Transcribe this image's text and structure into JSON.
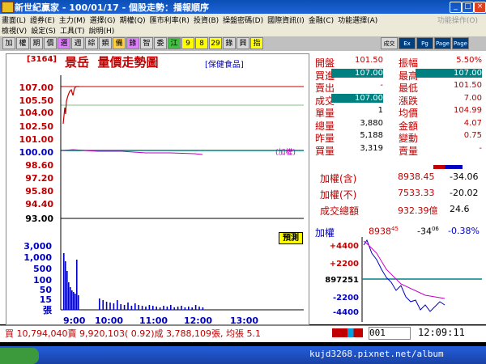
{
  "window": {
    "title": "新世紀贏家 - 100/01/17 - 個股走勢：播報順序"
  },
  "menu": {
    "row1": [
      "畫面(L)",
      "證券(E)",
      "主力(M)",
      "選擇(G)",
      "期權(Q)",
      "匯市利率(R)",
      "投資(B)",
      "操盤密碼(D)",
      "國際資訊(I)",
      "金融(C)",
      "功能選擇(A)"
    ],
    "row2": [
      "檢視(V)",
      "設定(S)",
      "工具(T)",
      "說明(H)"
    ],
    "right": "功能操作(O)"
  },
  "toolbar": {
    "buttons": [
      "加",
      "權",
      "期",
      "價",
      "選",
      "週",
      "綜",
      "類",
      "備",
      "錄",
      "智",
      "委",
      "江",
      "9",
      "8",
      "29",
      "錄",
      "興",
      "指"
    ],
    "right": [
      "成交",
      "Ex",
      "Pg",
      "Page",
      "Page"
    ]
  },
  "stock": {
    "code": "[3164]",
    "name": "景岳",
    "chart_title": "量價走勢圖",
    "category": "[保健食品]",
    "weight_tag": "(加權)"
  },
  "quote": {
    "rows": [
      {
        "l": "開盤",
        "v": "101.50",
        "l2": "振幅",
        "v2": "5.50%"
      },
      {
        "l": "買進",
        "v": "107.00",
        "l2": "最高",
        "v2": "107.00"
      },
      {
        "l": "賣出",
        "v": "-",
        "l2": "最低",
        "v2": "101.50"
      },
      {
        "l": "成交",
        "v": "107.00",
        "l2": "漲跌",
        "v2": "7.00"
      },
      {
        "l": "單量",
        "v": "1",
        "l2": "均價",
        "v2": "104.99"
      },
      {
        "l": "總量",
        "v": "3,880",
        "l2": "金額",
        "v2": "4.07"
      },
      {
        "l": "昨量",
        "v": "5,188",
        "l2": "變動",
        "v2": "0.75"
      },
      {
        "l": "買量",
        "v": "3,319",
        "l2": "賣量",
        "v2": "-"
      }
    ]
  },
  "index": {
    "rows": [
      {
        "label": "加權(含)",
        "value": "8938.45",
        "change": "-34.06"
      },
      {
        "label": "加權(不)",
        "value": "7533.33",
        "change": "-20.02"
      },
      {
        "label": "成交總額",
        "value": "932.39億",
        "change": "24.6"
      }
    ],
    "mini_label": "加權",
    "mini_value": "8938",
    "mini_value_sup": "45",
    "mini_change": "-34",
    "mini_change_sup": "06",
    "mini_pct": "-0.38%",
    "mini_yticks": [
      "+4400",
      "+2200",
      "897251",
      "-2200",
      "-4400"
    ]
  },
  "chart_data": {
    "type": "line",
    "price_ticks": [
      "107.00",
      "105.50",
      "104.00",
      "102.50",
      "101.00",
      "100.00",
      "98.60",
      "97.20",
      "95.80",
      "94.40",
      "93.00"
    ],
    "volume_ticks": [
      "3,000",
      "1,000",
      "500",
      "100",
      "50",
      "15",
      "張"
    ],
    "x_ticks": [
      "9:00",
      "10:00",
      "11:00",
      "12:00",
      "13:00"
    ],
    "volume_tag": "預測"
  },
  "status": {
    "text": "買 10,794,040賣 9,920,103( 0.92)成 3,788,109張, 均張 5.1",
    "page": "001",
    "clock": "12:09:11"
  },
  "taskbar": {
    "url": "kujd3268.pixnet.net/album"
  }
}
